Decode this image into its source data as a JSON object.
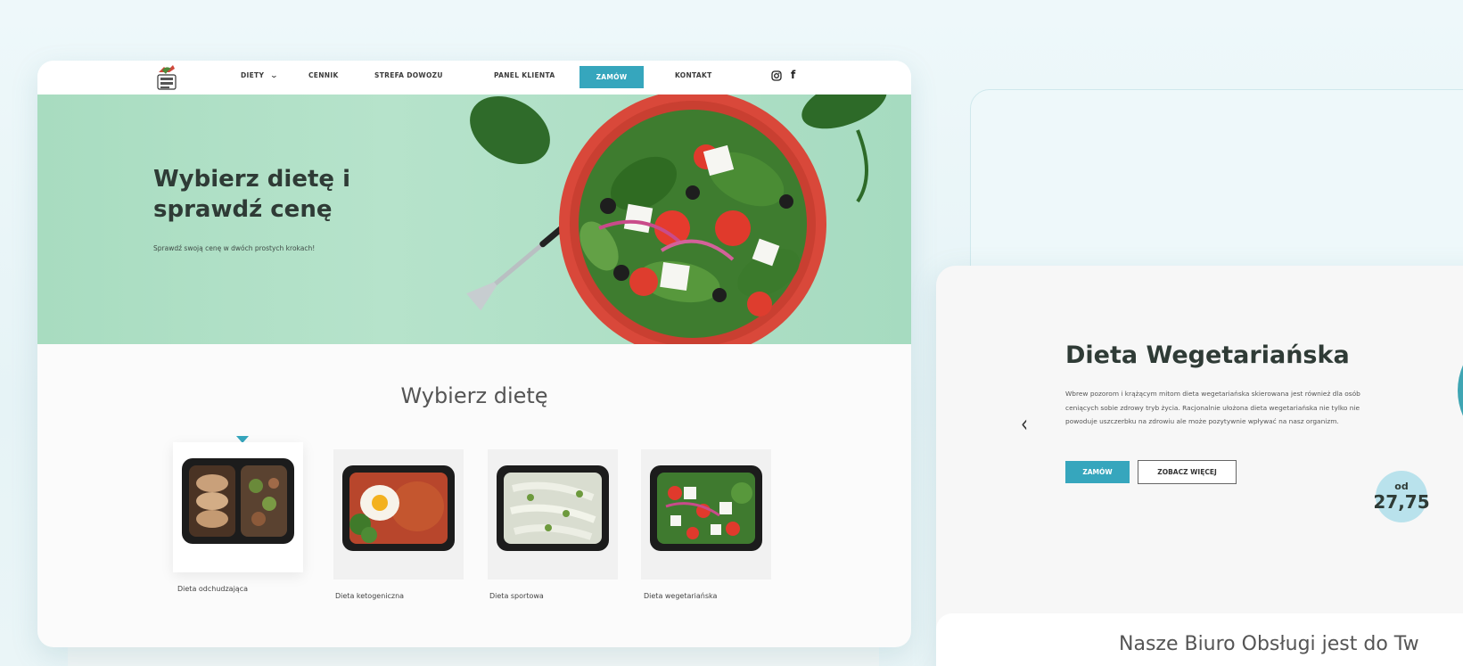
{
  "nav": {
    "items": [
      "DIETY",
      "CENNIK",
      "STREFA DOWOZU",
      "PANEL KLIENTA",
      "ZAMÓW",
      "KONTAKT"
    ],
    "social_icons": [
      "instagram-icon",
      "facebook-icon"
    ]
  },
  "hero": {
    "title": "Wybierz dietę i sprawdź cenę",
    "subtitle": "Sprawdź swoją cenę w dwóch prostych krokach!"
  },
  "diets": {
    "heading": "Wybierz dietę",
    "items": [
      {
        "label": "Dieta odchudzająca"
      },
      {
        "label": "Dieta ketogeniczna"
      },
      {
        "label": "Dieta sportowa"
      },
      {
        "label": "Dieta wegetariańska"
      }
    ]
  },
  "detail": {
    "title": "Dieta Wegetariańska",
    "description": "Wbrew pozorom i krążącym mitom dieta wegetariańska skierowana jest również dla osób ceniących sobie zdrowy tryb życia. Racjonalnie ułożona dieta wegetariańska nie tylko nie powoduje uszczerbku na zdrowiu ale może pozytywnie wpływać na nasz organizm.",
    "order_label": "ZAMÓW",
    "more_label": "ZOBACZ WIĘCEJ",
    "price_prefix": "od",
    "price": "27,75",
    "footer_text": "Nasze Biuro Obsługi jest do Tw"
  },
  "colors": {
    "accent": "#36a6bd",
    "hero_bg": "#b6e3cb",
    "price_bubble": "#b9e2ec"
  }
}
